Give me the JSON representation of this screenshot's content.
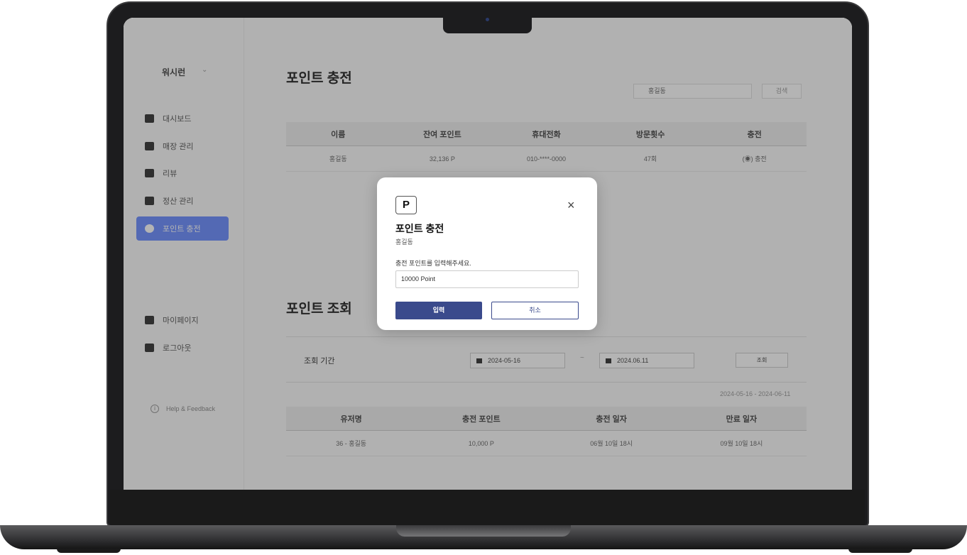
{
  "sidebar": {
    "brand": "워시런",
    "chevron": "⌄",
    "items": [
      {
        "label": "대시보드",
        "icon": "dashboard-icon"
      },
      {
        "label": "매장 관리",
        "icon": "store-icon"
      },
      {
        "label": "리뷰",
        "icon": "review-icon"
      },
      {
        "label": "정산 관리",
        "icon": "settlement-icon"
      },
      {
        "label": "포인트 충전",
        "icon": "point-icon",
        "active": true
      }
    ],
    "bottom_items": [
      {
        "label": "마이페이지",
        "icon": "user-icon"
      },
      {
        "label": "로그아웃",
        "icon": "logout-icon"
      }
    ],
    "help": "Help & Feedback"
  },
  "charge": {
    "title": "포인트 충전",
    "search_value": "홍길동",
    "search_button": "검색",
    "columns": [
      "이름",
      "잔여 포인트",
      "휴대전화",
      "방문횟수",
      "충전"
    ],
    "rows": [
      {
        "name": "홍길동",
        "points": "32,136 P",
        "phone": "010-****-0000",
        "visits": "47회",
        "action": "충전"
      }
    ]
  },
  "history": {
    "title": "포인트 조회",
    "period_label": "조회 기간",
    "start_date": "2024-05-16",
    "end_date": "2024.06.11",
    "tilde": "~",
    "query_button": "조회",
    "range_text": "2024-05-16 - 2024-06-11",
    "columns": [
      "유저명",
      "충전 포인트",
      "충전 일자",
      "만료 일자"
    ],
    "rows": [
      {
        "user": "36 - 홍길동",
        "points": "10,000 P",
        "charged": "06월 10일 18시",
        "expires": "09월 10일 18시"
      }
    ]
  },
  "modal": {
    "badge": "P",
    "close": "×",
    "title": "포인트 충전",
    "subtitle": "홍길동",
    "label": "충전 포인트를 입력해주세요.",
    "input_value": "10000 Point",
    "ok": "입력",
    "cancel": "취소"
  }
}
